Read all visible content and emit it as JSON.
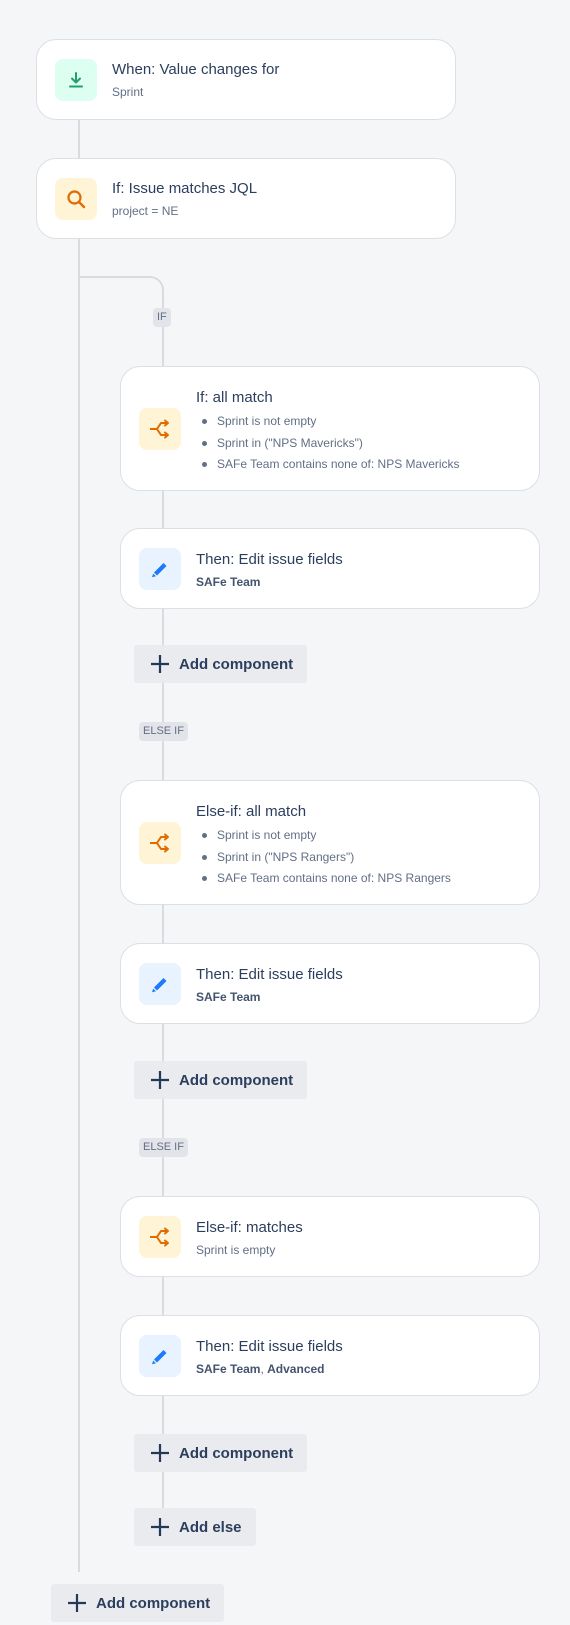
{
  "trigger": {
    "title": "When: Value changes for",
    "subtitle": "Sprint",
    "icon": "download-arrow-icon"
  },
  "condition": {
    "title": "If: Issue matches JQL",
    "subtitle": "project = NE",
    "icon": "search-icon"
  },
  "branch": {
    "if_badge": "IF",
    "else_if_badge": "ELSE IF",
    "blocks": [
      {
        "title": "If: all match",
        "conditions": [
          "Sprint is not empty",
          "Sprint in (\"NPS Mavericks\")",
          "SAFe Team contains none of: NPS Mavericks"
        ],
        "action_title": "Then: Edit issue fields",
        "action_fields": "SAFe Team"
      },
      {
        "title": "Else-if: all match",
        "conditions": [
          "Sprint is not empty",
          "Sprint in (\"NPS Rangers\")",
          "SAFe Team contains none of: NPS Rangers"
        ],
        "action_title": "Then: Edit issue fields",
        "action_fields": "SAFe Team"
      },
      {
        "title": "Else-if: matches",
        "subtitle": "Sprint is empty",
        "action_title": "Then: Edit issue fields",
        "action_field_1": "SAFe Team",
        "action_field_sep": ", ",
        "action_field_2": "Advanced"
      }
    ]
  },
  "buttons": {
    "add_component": "Add component",
    "add_else": "Add else"
  },
  "colors": {
    "background": "#f5f6f8",
    "trigger_icon": "#22a06b",
    "condition_icon": "#e06c00",
    "edit_icon": "#1d7afc",
    "connector": "#d9dbe0"
  }
}
